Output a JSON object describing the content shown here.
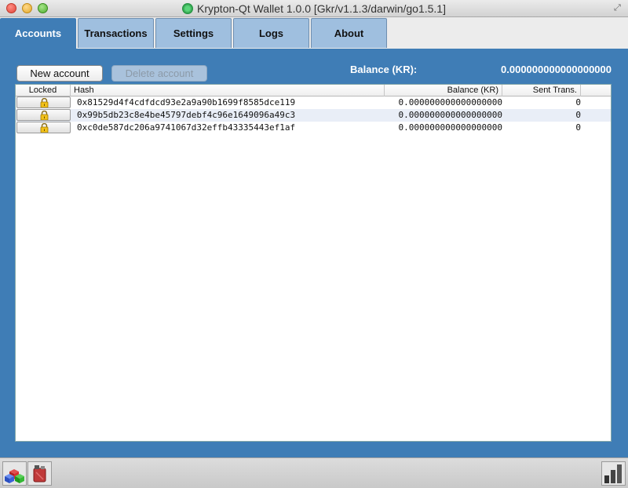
{
  "window": {
    "title": "Krypton-Qt Wallet 1.0.0 [Gkr/v1.1.3/darwin/go1.5.1]"
  },
  "tabs": [
    {
      "label": "Accounts",
      "active": true
    },
    {
      "label": "Transactions",
      "active": false
    },
    {
      "label": "Settings",
      "active": false
    },
    {
      "label": "Logs",
      "active": false
    },
    {
      "label": "About",
      "active": false
    }
  ],
  "accounts": {
    "new_account_label": "New account",
    "delete_account_label": "Delete account",
    "balance_label": "Balance (KR):",
    "balance_value": "0.000000000000000000",
    "columns": [
      "Locked",
      "Hash",
      "Balance (KR)",
      "Sent Trans."
    ],
    "rows": [
      {
        "locked": true,
        "hash": "0x81529d4f4cdfdcd93e2a9a90b1699f8585dce119",
        "balance": "0.000000000000000000",
        "sent": "0"
      },
      {
        "locked": true,
        "hash": "0x99b5db23c8e4be45797debf4c96e1649096a49c3",
        "balance": "0.000000000000000000",
        "sent": "0"
      },
      {
        "locked": true,
        "hash": "0xc0de587dc206a9741067d32effb43335443ef1af",
        "balance": "0.000000000000000000",
        "sent": "0"
      }
    ]
  },
  "statusbar": {
    "icons": [
      "peers-cubes-icon",
      "fuel-can-icon",
      "signal-strength-icon"
    ]
  },
  "colors": {
    "panel": "#3f7db6",
    "tab_inactive": "#9fbfdf"
  }
}
